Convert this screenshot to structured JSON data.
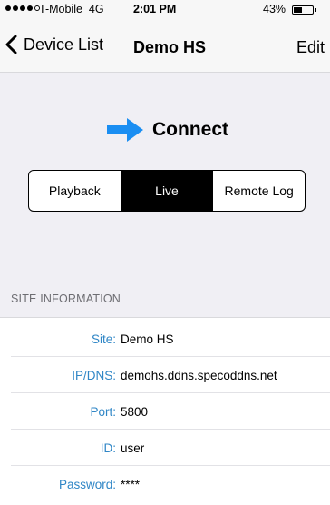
{
  "status_bar": {
    "carrier": "T-Mobile",
    "network": "4G",
    "time": "2:01 PM",
    "battery": "43%",
    "battery_level": 0.43,
    "signal_bars": 4
  },
  "nav": {
    "back_label": "Device List",
    "title": "Demo HS",
    "edit_label": "Edit"
  },
  "connect": {
    "label": "Connect",
    "arrow_color": "#1a8ef2"
  },
  "modes": {
    "items": [
      "Playback",
      "Live",
      "Remote Log"
    ],
    "selected": "Live"
  },
  "site_info": {
    "header": "SITE INFORMATION",
    "label_color": "#2f86c6",
    "rows": [
      {
        "label": "Site:",
        "value": "Demo HS"
      },
      {
        "label": "IP/DNS:",
        "value": "demohs.ddns.specoddns.net"
      },
      {
        "label": "Port:",
        "value": "5800"
      },
      {
        "label": "ID:",
        "value": "user"
      },
      {
        "label": "Password:",
        "value": "****"
      }
    ]
  }
}
